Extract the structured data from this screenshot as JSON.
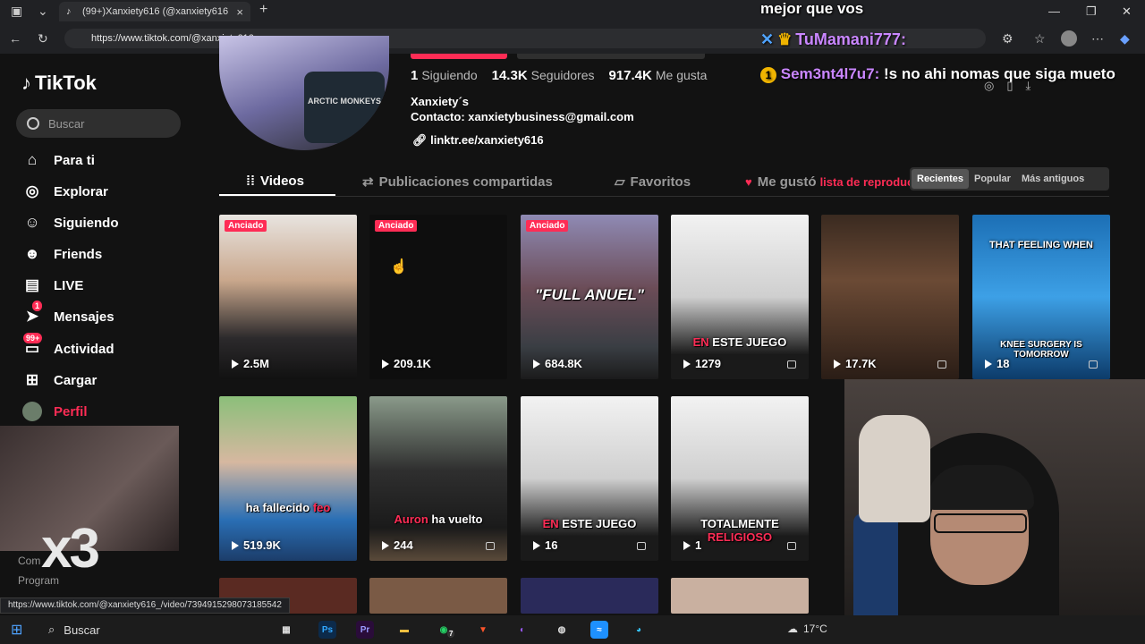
{
  "browser": {
    "tab_title": "(99+)Xanxiety616 (@xanxiety616",
    "url": "https://www.tiktok.com/@xanxiety616_",
    "status_url": "https://www.tiktok.com/@xanxiety616_/video/7394915298073185542"
  },
  "overlay": {
    "top_text": "mejor que vos",
    "chat1_user": "TuMamani777:",
    "chat2_badge": "1",
    "chat2_user": "Sem3nt4l7u7:",
    "chat2_text": " !s no ahi nomas que siga mueto"
  },
  "sidebar": {
    "logo": "TikTok",
    "search_placeholder": "Buscar",
    "items": [
      {
        "label": "Para ti",
        "icon": "home-icon"
      },
      {
        "label": "Explorar",
        "icon": "compass-icon"
      },
      {
        "label": "Siguiendo",
        "icon": "following-icon"
      },
      {
        "label": "Friends",
        "icon": "friends-icon"
      },
      {
        "label": "LIVE",
        "icon": "live-icon"
      },
      {
        "label": "Mensajes",
        "icon": "messages-icon",
        "badge": "1"
      },
      {
        "label": "Actividad",
        "icon": "activity-icon",
        "badge": "99+"
      },
      {
        "label": "Cargar",
        "icon": "upload-icon"
      },
      {
        "label": "Perfil",
        "icon": "avatar"
      }
    ],
    "footer": [
      "Com",
      "Program"
    ],
    "overlay_text": "x3"
  },
  "profile": {
    "shirt_text": "ARCTIC MONKEYS",
    "following_count": "1",
    "following_label": "Siguiendo",
    "followers_count": "14.3K",
    "followers_label": "Seguidores",
    "likes_count": "917.4K",
    "likes_label": "Me gusta",
    "bio_line1": "Xanxiety´s",
    "bio_line2": "Contacto: xanxietybusiness@gmail.com",
    "link": "linktr.ee/xanxiety616"
  },
  "tabs": {
    "videos": "Videos",
    "reposts": "Publicaciones compartidas",
    "favorites": "Favoritos",
    "liked": "Me gustó",
    "playlist": "lista de reproducción"
  },
  "sort": [
    "Recientes",
    "Popular",
    "Más antiguos"
  ],
  "videos": [
    {
      "views": "2.5M",
      "pinned": "Anciado",
      "caption": ""
    },
    {
      "views": "209.1K",
      "pinned": "Anciado",
      "caption": ""
    },
    {
      "views": "684.8K",
      "pinned": "Anciado",
      "caption": "\"FULL ANUEL\""
    },
    {
      "views": "1279",
      "pinned": "",
      "caption": "ESTE JUEGO",
      "caption_red": "EN "
    },
    {
      "views": "17.7K",
      "pinned": "",
      "caption": ""
    },
    {
      "views": "18",
      "pinned": "",
      "caption_top": "THAT FEELING WHEN",
      "caption": "KNEE SURGERY IS TOMORROW"
    },
    {
      "views": "519.9K",
      "pinned": "",
      "caption": "ha fallecido ",
      "caption_red": "feo"
    },
    {
      "views": "244",
      "pinned": "",
      "caption": " ha vuelto",
      "caption_red": "Auron"
    },
    {
      "views": "16",
      "pinned": "",
      "caption": "ESTE JUEGO",
      "caption_red": "EN "
    },
    {
      "views": "1",
      "pinned": "",
      "caption": "TOTALMENTE ",
      "caption_red": "RELIGIOSO"
    }
  ],
  "taskbar": {
    "search": "Buscar",
    "temp": "17°C",
    "whatsapp_badge": "7"
  },
  "colors": {
    "accent": "#fe2c55",
    "bg": "#121212"
  }
}
